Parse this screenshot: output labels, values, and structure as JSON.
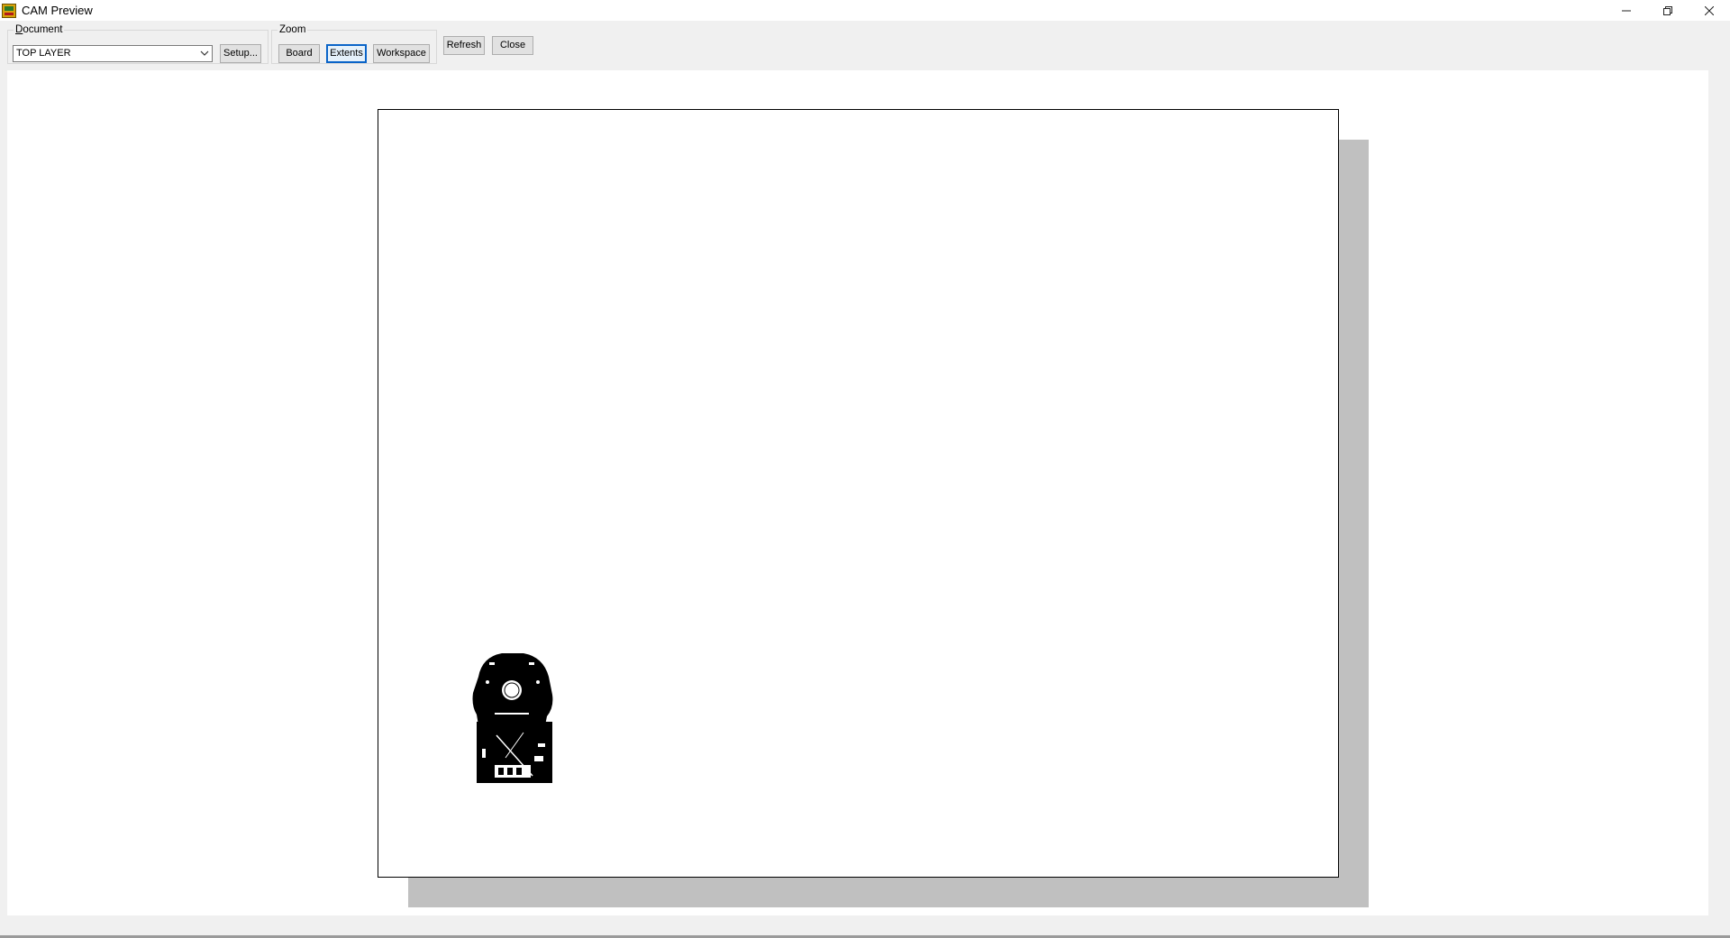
{
  "window": {
    "title": "CAM Preview",
    "app_icon": "cam-app-icon",
    "controls": [
      "minimize-icon",
      "restore-icon",
      "close-icon"
    ]
  },
  "document_group": {
    "legend": "Document",
    "legend_mnemonic": "D",
    "select_value": "TOP LAYER",
    "setup_label": "Setup...",
    "setup_mnemonic": "S"
  },
  "zoom_group": {
    "legend": "Zoom",
    "board_label": "Board",
    "board_mnemonic": "B",
    "extents_label": "Extents",
    "extents_mnemonic": "E",
    "workspace_label": "Workspace",
    "workspace_mnemonic": "W"
  },
  "actions": {
    "refresh_label": "Refresh",
    "refresh_mnemonic": "R",
    "close_label": "Close",
    "close_mnemonic": "C"
  },
  "colors": {
    "accent_focus": "#0a64c8",
    "page_shadow": "#c0c0c0",
    "board_fill": "#000000"
  }
}
